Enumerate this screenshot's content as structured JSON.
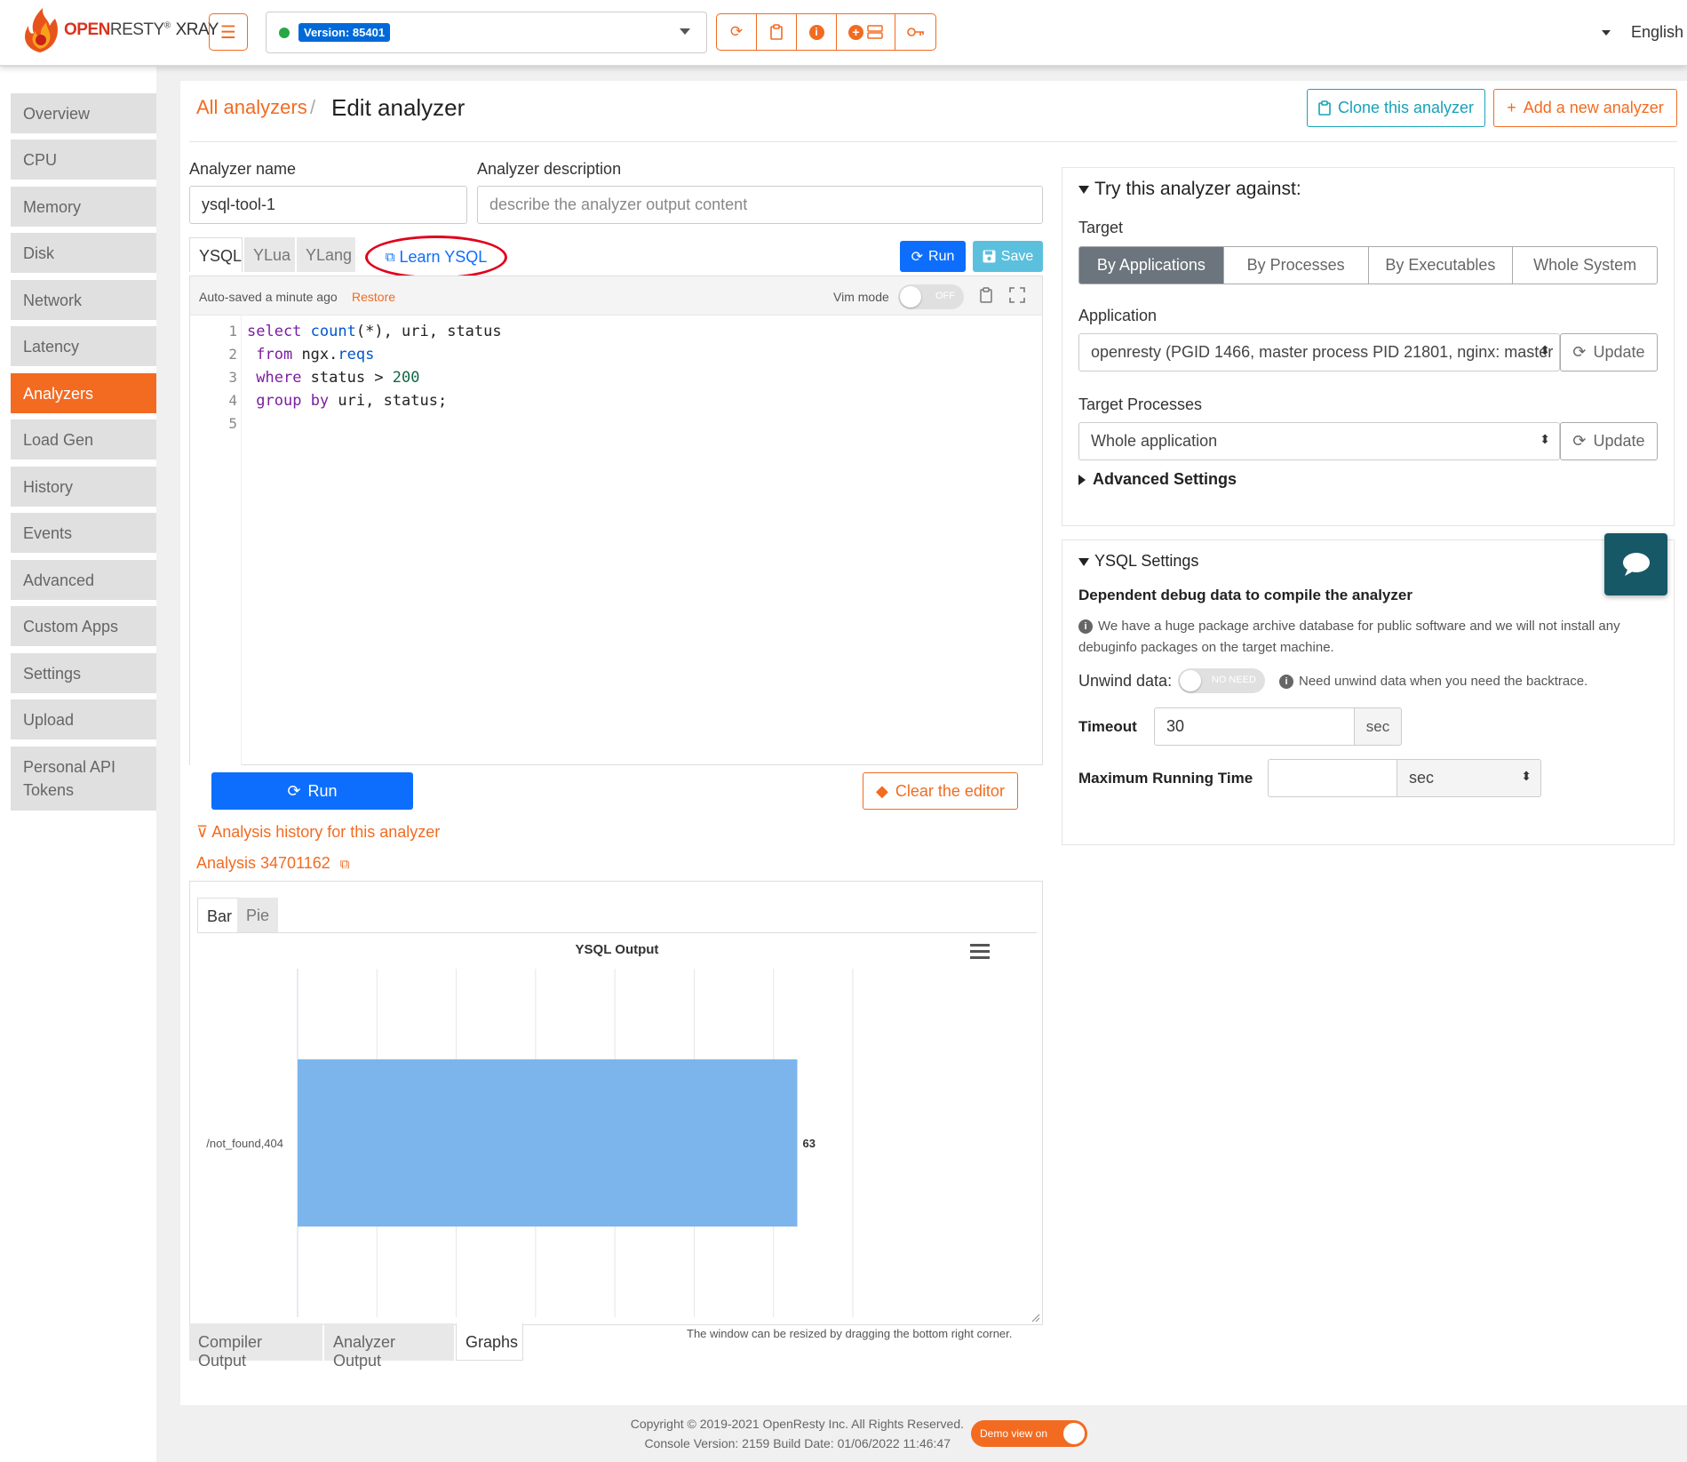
{
  "topbar": {
    "logo_open": "OPEN",
    "logo_resty": "RESTY",
    "logo_reg": "®",
    "logo_xray": "XRAY",
    "version_label": "Version: 85401",
    "language": "English"
  },
  "sidebar": {
    "items": [
      {
        "label": "Overview"
      },
      {
        "label": "CPU"
      },
      {
        "label": "Memory"
      },
      {
        "label": "Disk"
      },
      {
        "label": "Network"
      },
      {
        "label": "Latency"
      },
      {
        "label": "Analyzers"
      },
      {
        "label": "Load Gen"
      },
      {
        "label": "History"
      },
      {
        "label": "Events"
      },
      {
        "label": "Advanced"
      },
      {
        "label": "Custom Apps"
      },
      {
        "label": "Settings"
      },
      {
        "label": "Upload"
      },
      {
        "label": "Personal API"
      },
      {
        "label": "Tokens"
      }
    ],
    "active": "Analyzers"
  },
  "breadcrumb": {
    "parent": "All analyzers",
    "separator": "/",
    "current": "Edit analyzer"
  },
  "header_buttons": {
    "clone": "Clone this analyzer",
    "add_new": "Add a new analyzer"
  },
  "form": {
    "name_label": "Analyzer name",
    "name_value": "ysql-tool-1",
    "desc_label": "Analyzer description",
    "desc_placeholder": "describe the analyzer output content"
  },
  "editor_tabs": [
    "YSQL",
    "YLua",
    "YLang"
  ],
  "learn_link": "Learn YSQL",
  "editor_buttons": {
    "run": "Run",
    "save": "Save"
  },
  "editor": {
    "autosaved": "Auto-saved a minute ago",
    "restore": "Restore",
    "vim_mode": "Vim mode",
    "vim_state": "OFF",
    "line_numbers": [
      "1",
      "2",
      "3",
      "4",
      "5"
    ]
  },
  "actions": {
    "run": "Run",
    "clear": "Clear the editor",
    "history_link": "Analysis history for this analyzer",
    "analysis_link": "Analysis 34701162"
  },
  "chart_tabs": [
    "Bar",
    "Pie"
  ],
  "chart_data": {
    "type": "bar",
    "orientation": "horizontal",
    "title": "YSQL Output",
    "categories": [
      "/not_found,404"
    ],
    "values": [
      63
    ],
    "xlim": [
      0,
      70
    ],
    "grid": true,
    "color": "#7cb5ec"
  },
  "resize_note": "The window can be resized by dragging the bottom right corner.",
  "output_tabs": [
    "Compiler Output",
    "Analyzer Output",
    "Graphs"
  ],
  "try_panel": {
    "title": "Try this analyzer against:",
    "target_label": "Target",
    "targets": [
      "By Applications",
      "By Processes",
      "By Executables",
      "Whole System"
    ],
    "active_target": "By Applications",
    "application_label": "Application",
    "application_value": "openresty (PGID 1466, master process PID 21801, nginx: master",
    "update": "Update",
    "target_processes_label": "Target Processes",
    "target_processes_value": "Whole application",
    "advanced": "Advanced Settings"
  },
  "ysql_settings": {
    "title": "YSQL Settings",
    "subtitle": "Dependent debug data to compile the analyzer",
    "note_line1": "We have a huge package archive database for public software and we will not install any",
    "note_line2": "debuginfo packages on the target machine.",
    "unwind_label": "Unwind data:",
    "unwind_toggle": "NO NEED",
    "unwind_note": "Need unwind data when you need the backtrace.",
    "timeout_label": "Timeout",
    "timeout_value": "30",
    "timeout_unit": "sec",
    "max_time_label": "Maximum Running Time",
    "max_time_value": "",
    "max_time_unit": "sec"
  },
  "footer": {
    "copyright": "Copyright © 2019-2021 OpenResty Inc. All Rights Reserved.",
    "console": "Console Version: 2159 Build Date: 01/06/2022 11:46:47",
    "demo": "Demo view on"
  }
}
